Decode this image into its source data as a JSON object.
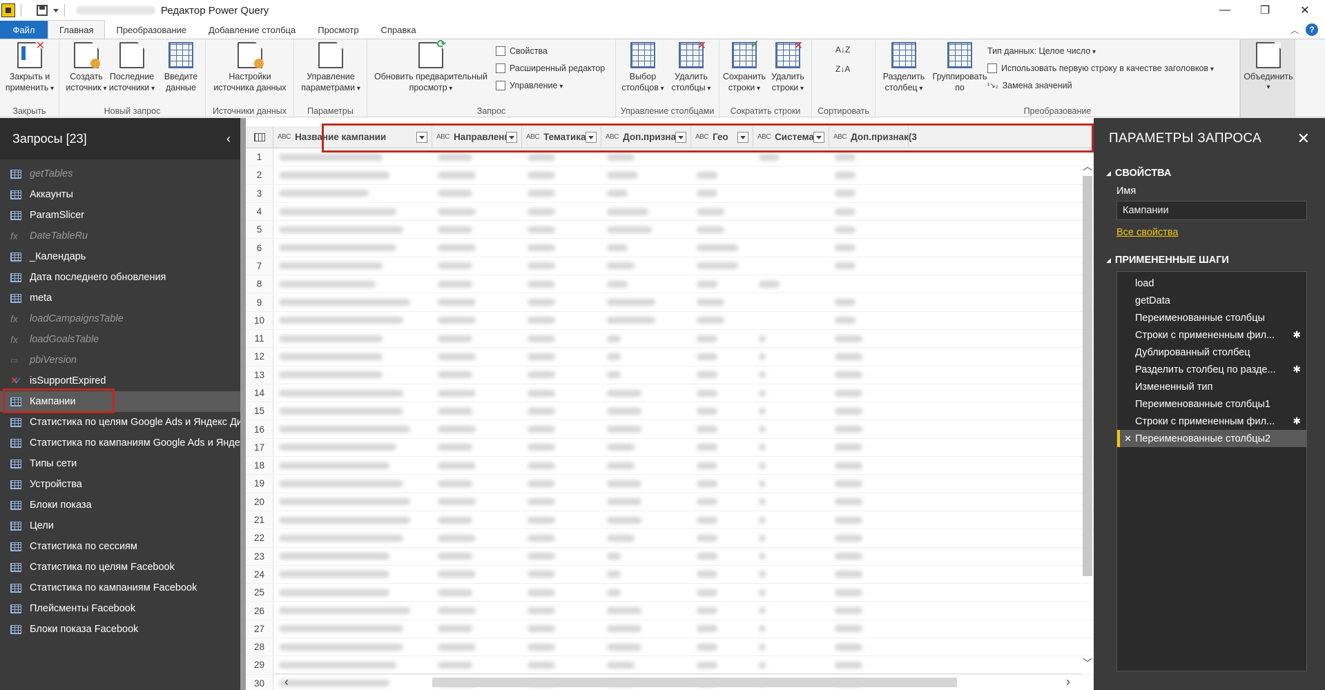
{
  "window": {
    "title": "Редактор Power Query",
    "controls": [
      "—",
      "❐",
      "✕"
    ]
  },
  "tabs": [
    "Файл",
    "Главная",
    "Преобразование",
    "Добавление столбца",
    "Просмотр",
    "Справка"
  ],
  "ribbon": {
    "close": {
      "btn": "Закрыть и применить",
      "group": "Закрыть"
    },
    "newquery": {
      "create": "Создать источник",
      "recent": "Последние источники",
      "enter": "Введите данные",
      "group": "Новый запрос"
    },
    "datasources": {
      "btn": "Настройки источника данных",
      "group": "Источники данных"
    },
    "params": {
      "btn": "Управление параметрами",
      "group": "Параметры"
    },
    "query": {
      "refresh": "Обновить предварительный просмотр",
      "props": "Свойства",
      "advanced": "Расширенный редактор",
      "manage": "Управление",
      "group": "Запрос"
    },
    "columns": {
      "choose": "Выбор столбцов",
      "remove": "Удалить столбцы",
      "group": "Управление столбцами"
    },
    "rows": {
      "keep": "Сохранить строки",
      "remove": "Удалить строки",
      "group": "Сократить строки"
    },
    "sort": {
      "group": "Сортировать"
    },
    "transform": {
      "split": "Разделить столбец",
      "groupby": "Группировать по",
      "datatype": "Тип данных: Целое число",
      "firstrow": "Использовать первую строку в качестве заголовков",
      "replace": "Замена значений",
      "group": "Преобразование"
    },
    "combine": {
      "btn": "Объединить"
    }
  },
  "queries": {
    "title": "Запросы [23]",
    "items": [
      {
        "label": "getTables",
        "kind": "table",
        "dim": true
      },
      {
        "label": "Аккаунты",
        "kind": "table"
      },
      {
        "label": "ParamSlicer",
        "kind": "table"
      },
      {
        "label": "DateTableRu",
        "kind": "fx",
        "dim": true
      },
      {
        "label": "_Календарь",
        "kind": "table"
      },
      {
        "label": "Дата последнего обновления",
        "kind": "table"
      },
      {
        "label": "meta",
        "kind": "table"
      },
      {
        "label": "loadCampaignsTable",
        "kind": "fx",
        "dim": true
      },
      {
        "label": "loadGoalsTable",
        "kind": "fx",
        "dim": true
      },
      {
        "label": "pbiVersion",
        "kind": "param",
        "dim": true
      },
      {
        "label": "isSupportExpired",
        "kind": "cross"
      },
      {
        "label": "Кампании",
        "kind": "table",
        "selected": true
      },
      {
        "label": "Статистика по целям Google Ads и Яндекс Директ",
        "kind": "table"
      },
      {
        "label": "Статистика по кампаниям Google Ads и Яндекс Дире...",
        "kind": "table"
      },
      {
        "label": "Типы сети",
        "kind": "table"
      },
      {
        "label": "Устройства",
        "kind": "table"
      },
      {
        "label": "Блоки показа",
        "kind": "table"
      },
      {
        "label": "Цели",
        "kind": "table"
      },
      {
        "label": "Статистика по сессиям",
        "kind": "table"
      },
      {
        "label": "Статистика по целям Facebook",
        "kind": "table"
      },
      {
        "label": "Статистика по кампаниям Facebook",
        "kind": "table"
      },
      {
        "label": "Плейсменты Facebook",
        "kind": "table"
      },
      {
        "label": "Блоки показа Facebook",
        "kind": "table"
      }
    ]
  },
  "grid": {
    "type_badge": "ABC",
    "columns": [
      {
        "label": "Название кампании"
      },
      {
        "label": "Направление"
      },
      {
        "label": "Тематика"
      },
      {
        "label": "Доп.признак"
      },
      {
        "label": "Гео"
      },
      {
        "label": "Система"
      },
      {
        "label": "Доп.признак(3"
      }
    ],
    "row_numbers": [
      "1",
      "2",
      "3",
      "4",
      "5",
      "6",
      "7",
      "8",
      "9",
      "10",
      "11",
      "12",
      "13",
      "14",
      "15",
      "16",
      "17",
      "18",
      "19",
      "20",
      "21",
      "22",
      "23",
      "24",
      "25",
      "26",
      "27",
      "28",
      "29",
      "30"
    ]
  },
  "settings": {
    "title": "ПАРАМЕТРЫ ЗАПРОСА",
    "properties_label": "СВОЙСТВА",
    "name_label": "Имя",
    "name_value": "Кампании",
    "all_props": "Все свойства",
    "steps_label": "ПРИМЕНЕННЫЕ ШАГИ",
    "steps": [
      {
        "label": "load"
      },
      {
        "label": "getData"
      },
      {
        "label": "Переименованные столбцы"
      },
      {
        "label": "Строки с примененным фил...",
        "gear": true
      },
      {
        "label": "Дублированный столбец"
      },
      {
        "label": "Разделить столбец по разде...",
        "gear": true
      },
      {
        "label": "Измененный тип"
      },
      {
        "label": "Переименованные столбцы1"
      },
      {
        "label": "Строки с примененным фил...",
        "gear": true
      },
      {
        "label": "Переименованные столбцы2",
        "current": true
      }
    ]
  }
}
